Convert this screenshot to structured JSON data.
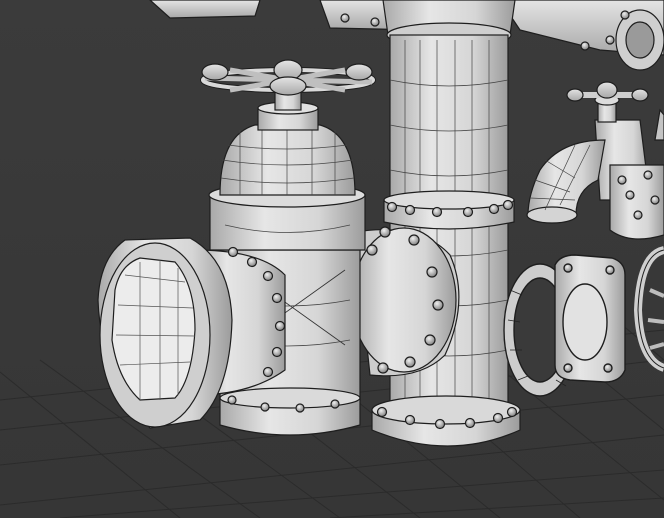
{
  "scene": {
    "background_color": "#3a3a3a",
    "grid_color": "#2b2b2b",
    "mesh_fill": "#d8d8d8",
    "mesh_shade": "#b9b9b9",
    "wire_color": "#1e1e1e",
    "objects": [
      "gate-valve",
      "handwheel",
      "vertical-pipe",
      "flange-ring",
      "faucet-spigot",
      "small-handwheel",
      "gasket-ring",
      "square-flange",
      "partial-wheel"
    ]
  }
}
